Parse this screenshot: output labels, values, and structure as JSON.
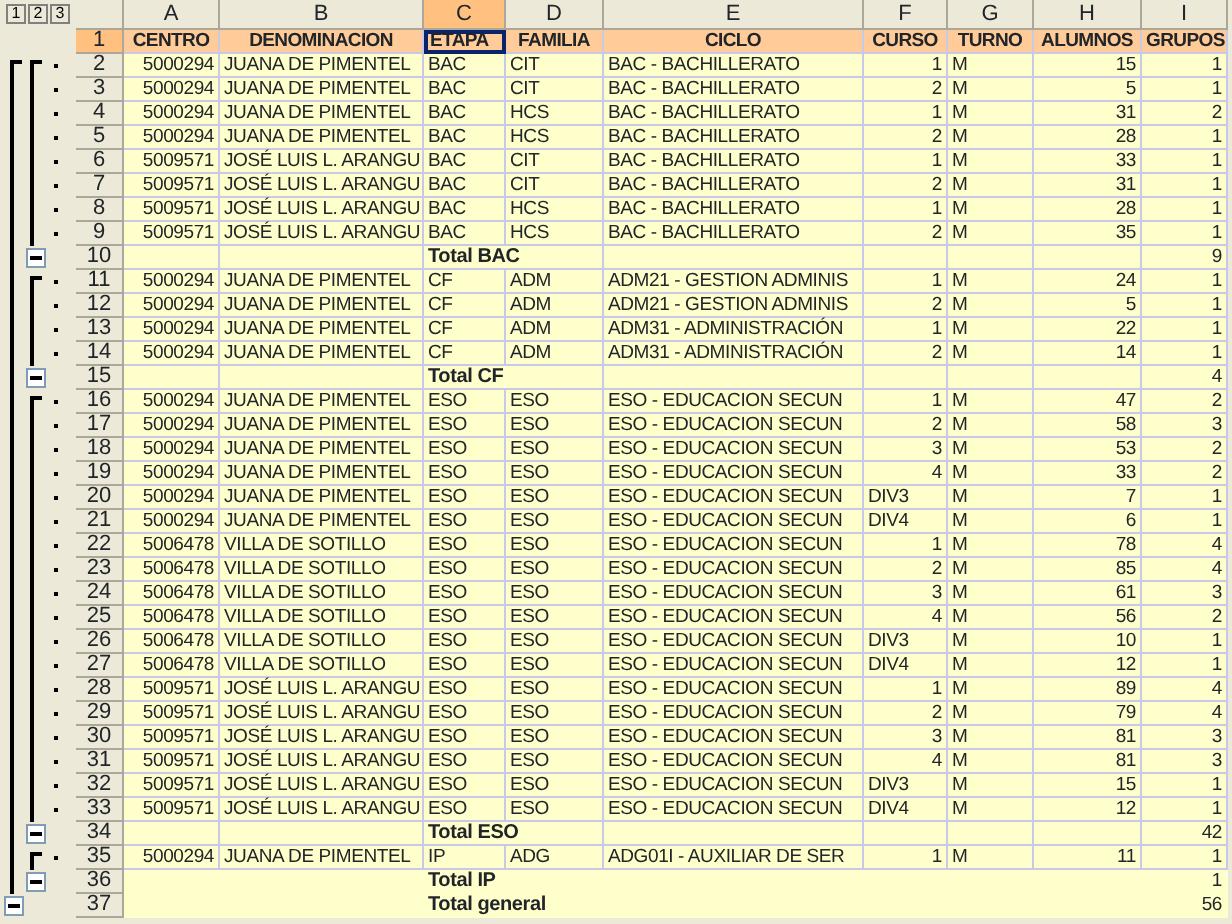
{
  "outline_levels": [
    "1",
    "2",
    "3"
  ],
  "columns": [
    {
      "letter": "A",
      "selected": false
    },
    {
      "letter": "B",
      "selected": false
    },
    {
      "letter": "C",
      "selected": true
    },
    {
      "letter": "D",
      "selected": false
    },
    {
      "letter": "E",
      "selected": false
    },
    {
      "letter": "F",
      "selected": false
    },
    {
      "letter": "G",
      "selected": false
    },
    {
      "letter": "H",
      "selected": false
    },
    {
      "letter": "I",
      "selected": false
    }
  ],
  "header_row": {
    "n": "1",
    "selected": true,
    "cells": [
      {
        "text": "CENTRO",
        "active": false
      },
      {
        "text": "DENOMINACION",
        "active": false
      },
      {
        "text": "ETAPA",
        "active": true
      },
      {
        "text": "FAMILIA",
        "active": false
      },
      {
        "text": "CICLO",
        "active": false
      },
      {
        "text": "CURSO",
        "active": false
      },
      {
        "text": "TURNO",
        "active": false
      },
      {
        "text": "ALUMNOS",
        "active": false
      },
      {
        "text": "GRUPOS",
        "active": false
      }
    ]
  },
  "rows": [
    {
      "n": "2",
      "kind": "detail",
      "cells": [
        "5000294",
        "JUANA DE PIMENTEL",
        "BAC",
        "CIT",
        "BAC - BACHILLERATO",
        "1",
        "M",
        "15",
        "1"
      ]
    },
    {
      "n": "3",
      "kind": "detail",
      "cells": [
        "5000294",
        "JUANA DE PIMENTEL",
        "BAC",
        "CIT",
        "BAC - BACHILLERATO",
        "2",
        "M",
        "5",
        "1"
      ]
    },
    {
      "n": "4",
      "kind": "detail",
      "cells": [
        "5000294",
        "JUANA DE PIMENTEL",
        "BAC",
        "HCS",
        "BAC - BACHILLERATO",
        "1",
        "M",
        "31",
        "2"
      ]
    },
    {
      "n": "5",
      "kind": "detail",
      "cells": [
        "5000294",
        "JUANA DE PIMENTEL",
        "BAC",
        "HCS",
        "BAC - BACHILLERATO",
        "2",
        "M",
        "28",
        "1"
      ]
    },
    {
      "n": "6",
      "kind": "detail",
      "cells": [
        "5009571",
        "JOSÉ LUIS L. ARANGU",
        "BAC",
        "CIT",
        "BAC - BACHILLERATO",
        "1",
        "M",
        "33",
        "1"
      ]
    },
    {
      "n": "7",
      "kind": "detail",
      "cells": [
        "5009571",
        "JOSÉ LUIS L. ARANGU",
        "BAC",
        "CIT",
        "BAC - BACHILLERATO",
        "2",
        "M",
        "31",
        "1"
      ]
    },
    {
      "n": "8",
      "kind": "detail",
      "cells": [
        "5009571",
        "JOSÉ LUIS L. ARANGU",
        "BAC",
        "HCS",
        "BAC - BACHILLERATO",
        "1",
        "M",
        "28",
        "1"
      ]
    },
    {
      "n": "9",
      "kind": "detail",
      "cells": [
        "5009571",
        "JOSÉ LUIS L. ARANGU",
        "BAC",
        "HCS",
        "BAC - BACHILLERATO",
        "2",
        "M",
        "35",
        "1"
      ]
    },
    {
      "n": "10",
      "kind": "subtotal",
      "label": "Total BAC",
      "count": "9"
    },
    {
      "n": "11",
      "kind": "detail",
      "cells": [
        "5000294",
        "JUANA DE PIMENTEL",
        "CF",
        "ADM",
        "ADM21 - GESTION ADMINIS",
        "1",
        "M",
        "24",
        "1"
      ]
    },
    {
      "n": "12",
      "kind": "detail",
      "cells": [
        "5000294",
        "JUANA DE PIMENTEL",
        "CF",
        "ADM",
        "ADM21 - GESTION ADMINIS",
        "2",
        "M",
        "5",
        "1"
      ]
    },
    {
      "n": "13",
      "kind": "detail",
      "cells": [
        "5000294",
        "JUANA DE PIMENTEL",
        "CF",
        "ADM",
        "ADM31 - ADMINISTRACIÓN",
        "1",
        "M",
        "22",
        "1"
      ]
    },
    {
      "n": "14",
      "kind": "detail",
      "cells": [
        "5000294",
        "JUANA DE PIMENTEL",
        "CF",
        "ADM",
        "ADM31 - ADMINISTRACIÓN",
        "2",
        "M",
        "14",
        "1"
      ]
    },
    {
      "n": "15",
      "kind": "subtotal",
      "label": "Total CF",
      "count": "4"
    },
    {
      "n": "16",
      "kind": "detail",
      "cells": [
        "5000294",
        "JUANA DE PIMENTEL",
        "ESO",
        "ESO",
        "ESO - EDUCACION SECUN",
        "1",
        "M",
        "47",
        "2"
      ]
    },
    {
      "n": "17",
      "kind": "detail",
      "cells": [
        "5000294",
        "JUANA DE PIMENTEL",
        "ESO",
        "ESO",
        "ESO - EDUCACION SECUN",
        "2",
        "M",
        "58",
        "3"
      ]
    },
    {
      "n": "18",
      "kind": "detail",
      "cells": [
        "5000294",
        "JUANA DE PIMENTEL",
        "ESO",
        "ESO",
        "ESO - EDUCACION SECUN",
        "3",
        "M",
        "53",
        "2"
      ]
    },
    {
      "n": "19",
      "kind": "detail",
      "cells": [
        "5000294",
        "JUANA DE PIMENTEL",
        "ESO",
        "ESO",
        "ESO - EDUCACION SECUN",
        "4",
        "M",
        "33",
        "2"
      ]
    },
    {
      "n": "20",
      "kind": "detail",
      "cells": [
        "5000294",
        "JUANA DE PIMENTEL",
        "ESO",
        "ESO",
        "ESO - EDUCACION SECUN",
        "DIV3",
        "M",
        "7",
        "1"
      ]
    },
    {
      "n": "21",
      "kind": "detail",
      "cells": [
        "5000294",
        "JUANA DE PIMENTEL",
        "ESO",
        "ESO",
        "ESO - EDUCACION SECUN",
        "DIV4",
        "M",
        "6",
        "1"
      ]
    },
    {
      "n": "22",
      "kind": "detail",
      "cells": [
        "5006478",
        "VILLA DE SOTILLO",
        "ESO",
        "ESO",
        "ESO - EDUCACION SECUN",
        "1",
        "M",
        "78",
        "4"
      ]
    },
    {
      "n": "23",
      "kind": "detail",
      "cells": [
        "5006478",
        "VILLA DE SOTILLO",
        "ESO",
        "ESO",
        "ESO - EDUCACION SECUN",
        "2",
        "M",
        "85",
        "4"
      ]
    },
    {
      "n": "24",
      "kind": "detail",
      "cells": [
        "5006478",
        "VILLA DE SOTILLO",
        "ESO",
        "ESO",
        "ESO - EDUCACION SECUN",
        "3",
        "M",
        "61",
        "3"
      ]
    },
    {
      "n": "25",
      "kind": "detail",
      "cells": [
        "5006478",
        "VILLA DE SOTILLO",
        "ESO",
        "ESO",
        "ESO - EDUCACION SECUN",
        "4",
        "M",
        "56",
        "2"
      ]
    },
    {
      "n": "26",
      "kind": "detail",
      "cells": [
        "5006478",
        "VILLA DE SOTILLO",
        "ESO",
        "ESO",
        "ESO - EDUCACION SECUN",
        "DIV3",
        "M",
        "10",
        "1"
      ]
    },
    {
      "n": "27",
      "kind": "detail",
      "cells": [
        "5006478",
        "VILLA DE SOTILLO",
        "ESO",
        "ESO",
        "ESO - EDUCACION SECUN",
        "DIV4",
        "M",
        "12",
        "1"
      ]
    },
    {
      "n": "28",
      "kind": "detail",
      "cells": [
        "5009571",
        "JOSÉ LUIS L. ARANGU",
        "ESO",
        "ESO",
        "ESO - EDUCACION SECUN",
        "1",
        "M",
        "89",
        "4"
      ]
    },
    {
      "n": "29",
      "kind": "detail",
      "cells": [
        "5009571",
        "JOSÉ LUIS L. ARANGU",
        "ESO",
        "ESO",
        "ESO - EDUCACION SECUN",
        "2",
        "M",
        "79",
        "4"
      ]
    },
    {
      "n": "30",
      "kind": "detail",
      "cells": [
        "5009571",
        "JOSÉ LUIS L. ARANGU",
        "ESO",
        "ESO",
        "ESO - EDUCACION SECUN",
        "3",
        "M",
        "81",
        "3"
      ]
    },
    {
      "n": "31",
      "kind": "detail",
      "cells": [
        "5009571",
        "JOSÉ LUIS L. ARANGU",
        "ESO",
        "ESO",
        "ESO - EDUCACION SECUN",
        "4",
        "M",
        "81",
        "3"
      ]
    },
    {
      "n": "32",
      "kind": "detail",
      "cells": [
        "5009571",
        "JOSÉ LUIS L. ARANGU",
        "ESO",
        "ESO",
        "ESO - EDUCACION SECUN",
        "DIV3",
        "M",
        "15",
        "1"
      ]
    },
    {
      "n": "33",
      "kind": "detail",
      "cells": [
        "5009571",
        "JOSÉ LUIS L. ARANGU",
        "ESO",
        "ESO",
        "ESO - EDUCACION SECUN",
        "DIV4",
        "M",
        "12",
        "1"
      ]
    },
    {
      "n": "34",
      "kind": "subtotal",
      "label": "Total ESO",
      "count": "42"
    },
    {
      "n": "35",
      "kind": "detail",
      "cells": [
        "5000294",
        "JUANA DE PIMENTEL",
        "IP",
        "ADG",
        "ADG01I - AUXILIAR DE SER",
        "1",
        "M",
        "11",
        "1"
      ]
    },
    {
      "n": "36",
      "kind": "subtotal",
      "label": "Total IP",
      "count": "1"
    },
    {
      "n": "37",
      "kind": "grand",
      "label": "Total general",
      "count": "56"
    }
  ]
}
